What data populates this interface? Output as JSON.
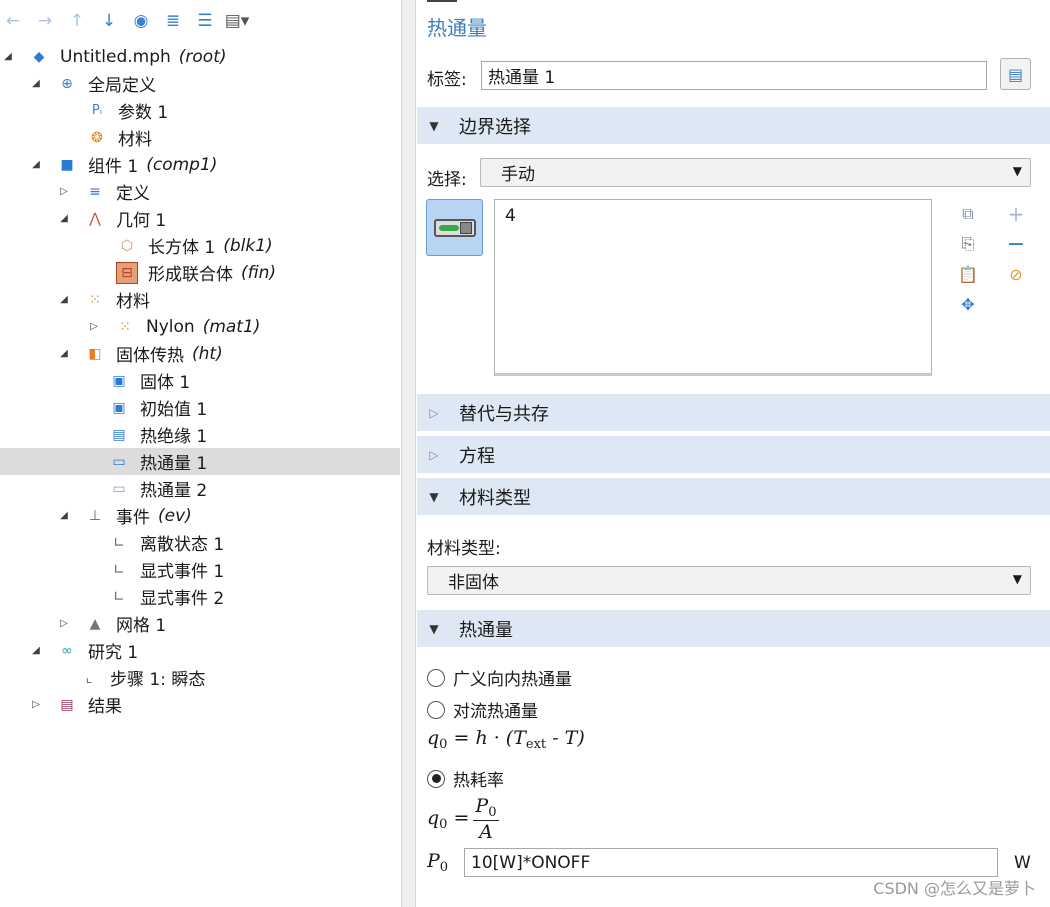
{
  "toolbar": {
    "buttons": [
      "back-arrow-icon",
      "forward-arrow-icon",
      "move-up-icon",
      "move-down-icon",
      "show-icon",
      "collapse-all-icon",
      "expand-all-icon",
      "view-options-icon"
    ]
  },
  "tree": {
    "root": {
      "name": "Untitled.mph",
      "tag": "(root)"
    },
    "global_defs": "全局定义",
    "param": "参数 1",
    "materials_global": "材料",
    "component": {
      "name": "组件 1",
      "tag": "(comp1)"
    },
    "definitions": "定义",
    "geometry": "几何 1",
    "block": {
      "name": "长方体 1",
      "tag": "(blk1)"
    },
    "form_union": {
      "name": "形成联合体",
      "tag": "(fin)"
    },
    "materials": "材料",
    "nylon": {
      "name": "Nylon",
      "tag": "(mat1)"
    },
    "ht": {
      "name": "固体传热",
      "tag": "(ht)"
    },
    "solid": "固体 1",
    "init": "初始值 1",
    "insulation": "热绝缘 1",
    "flux1": "热通量 1",
    "flux2": "热通量 2",
    "events": {
      "name": "事件",
      "tag": "(ev)"
    },
    "discrete": "离散状态 1",
    "explicit1": "显式事件 1",
    "explicit2": "显式事件 2",
    "mesh": "网格 1",
    "study": "研究 1",
    "step": "步骤 1: 瞬态",
    "results": "结果"
  },
  "panel": {
    "title": "热通量",
    "label_caption": "标签:",
    "label_value": "热通量 1",
    "sections": {
      "boundary": "边界选择",
      "override": "替代与共存",
      "equation": "方程",
      "material_type": "材料类型",
      "heat_flux": "热通量"
    },
    "selection_caption": "选择:",
    "selection_value": "手动",
    "selected_boundaries": "4",
    "material_type_caption": "材料类型:",
    "material_type_value": "非固体",
    "radio": {
      "general": "广义向内热通量",
      "convective": "对流热通量",
      "heat_rate": "热耗率"
    },
    "p0_value": "10[W]*ONOFF",
    "p0_unit": "W"
  },
  "colors": {
    "accent": "#3a7fc0",
    "section_bg": "#dde8f4",
    "selected_row": "#dcdcdc"
  },
  "watermark": "CSDN @怎么又是萝卜"
}
